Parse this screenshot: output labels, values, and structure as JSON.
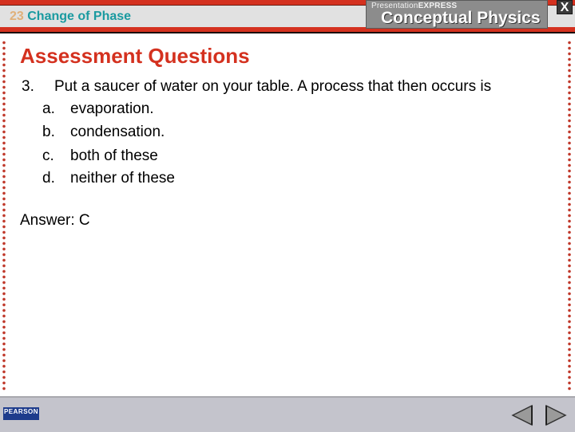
{
  "header": {
    "chapter_number": "23",
    "chapter_title": "Change of Phase",
    "brand_prefix": "Presentation",
    "brand_suffix": "EXPRESS",
    "product_name": "Conceptual Physics",
    "close_label": "X"
  },
  "slide": {
    "title": "Assessment Questions",
    "question": {
      "number": "3.",
      "text": "Put a saucer of water on your table. A process that then occurs is",
      "options": [
        {
          "letter": "a.",
          "text": "evaporation."
        },
        {
          "letter": "b.",
          "text": "condensation."
        },
        {
          "letter": "c.",
          "text": "both of these"
        },
        {
          "letter": "d.",
          "text": "neither of these"
        }
      ]
    },
    "answer": "Answer: C"
  },
  "footer": {
    "publisher_logo": "PEARSON",
    "prev_icon": "triangle-left-icon",
    "next_icon": "triangle-right-icon"
  },
  "colors": {
    "accent_red": "#d4311f",
    "chapter_teal": "#1a9aa0",
    "chapter_number": "#e0b07a"
  }
}
